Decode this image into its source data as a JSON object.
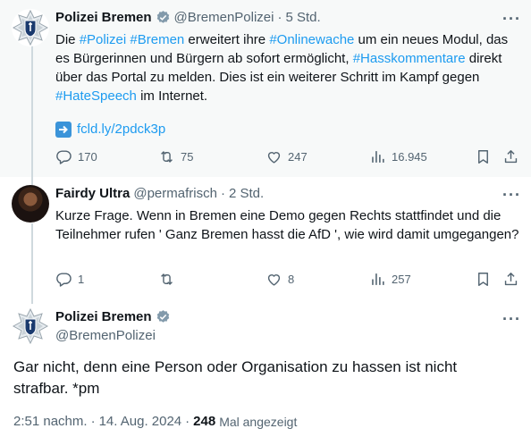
{
  "tweet1": {
    "name": "Polizei Bremen",
    "handle": "@BremenPolizei",
    "time": "5 Std.",
    "text": {
      "t1": "Die ",
      "h1": "#Polizei",
      "t2": " ",
      "h2": "#Bremen",
      "t3": " erweitert ihre ",
      "h3": "#Onlinewache",
      "t4": " um ein neues Modul, das es Bürgerinnen und Bürgern ab sofort ermöglicht, ",
      "h4": "#Hasskommentare",
      "t5": " direkt über das Portal zu melden. Dies ist ein weiterer Schritt im Kampf gegen ",
      "h5": "#HateSpeech",
      "t6": " im Internet."
    },
    "link_emoji": "➡️",
    "link_text": "fcld.ly/2pdck3p",
    "actions": {
      "replies": "170",
      "reposts": "75",
      "likes": "247",
      "views": "16.945"
    }
  },
  "tweet2": {
    "name": "Fairdy Ultra",
    "handle": "@permafrisch",
    "time": "2 Std.",
    "text": "Kurze Frage. Wenn in Bremen eine Demo gegen Rechts stattfindet und die Teilnehmer rufen ' Ganz Bremen hasst die AfD ', wie wird damit umgegangen?",
    "actions": {
      "replies": "1",
      "reposts": "",
      "likes": "8",
      "views": "257"
    }
  },
  "main": {
    "name": "Polizei Bremen",
    "handle": "@BremenPolizei",
    "text": "Gar nicht, denn eine Person oder Organisation zu hassen ist nicht strafbar. *pm",
    "time": "2:51 nachm.",
    "date": "14. Aug. 2024",
    "views_count": "248",
    "views_label": "Mal angezeigt"
  },
  "separator": "·",
  "icons": {
    "verified": "verified-badge-icon",
    "reply": "reply-icon",
    "repost": "repost-icon",
    "like": "heart-icon",
    "views": "views-icon",
    "bookmark": "bookmark-icon",
    "share": "share-icon",
    "more": "more-icon"
  },
  "colors": {
    "accent": "#1d9bf0",
    "muted": "#536471",
    "text": "#0f1419",
    "highlight_bg": "#f7f9f9",
    "thread_line": "#cfd9de"
  }
}
